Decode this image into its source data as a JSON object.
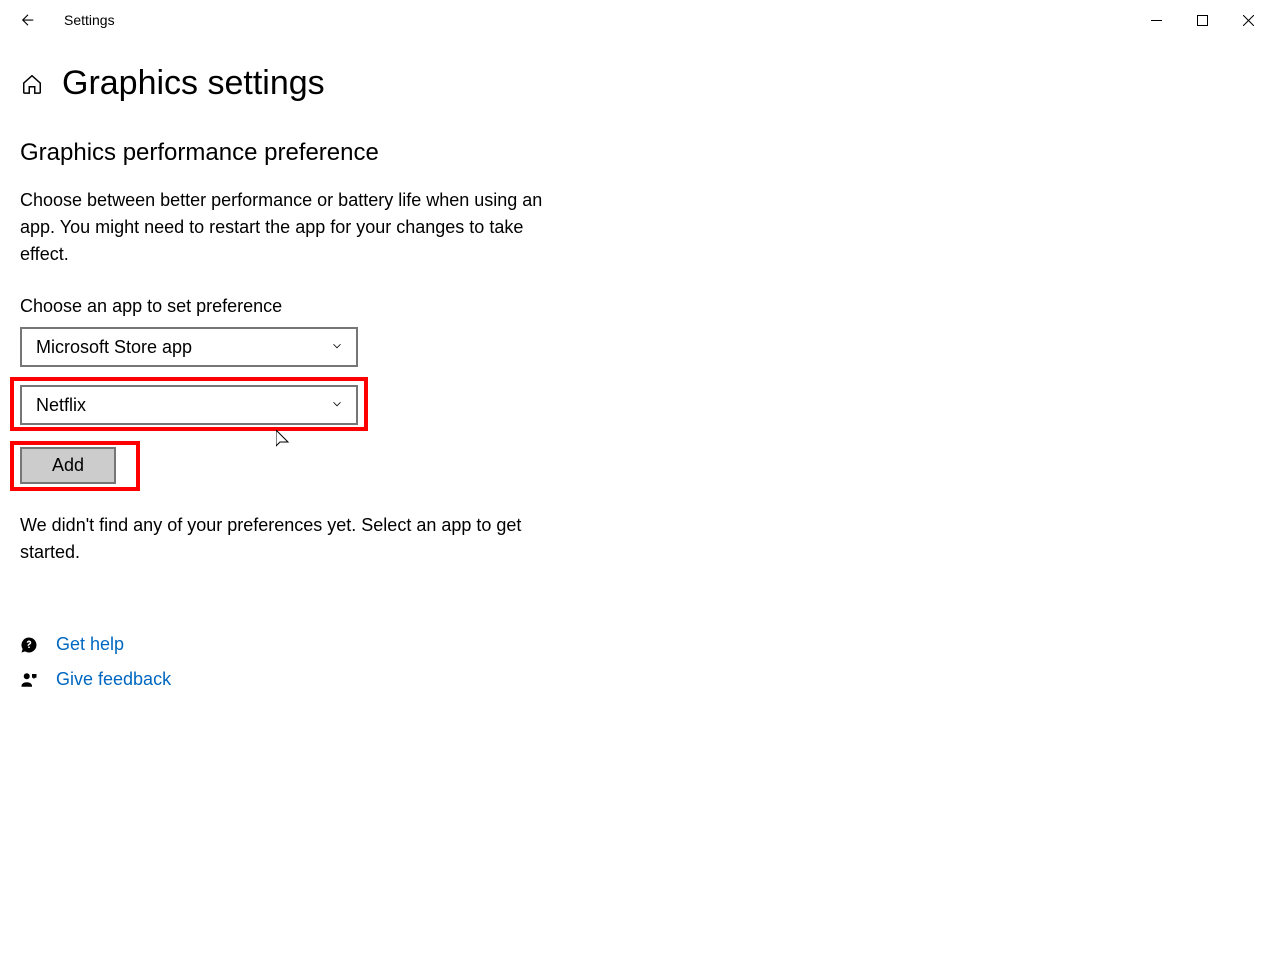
{
  "titlebar": {
    "app_name": "Settings"
  },
  "page": {
    "title": "Graphics settings",
    "section_title": "Graphics performance preference",
    "description": "Choose between better performance or battery life when using an app. You might need to restart the app for your changes to take effect.",
    "dropdown_label": "Choose an app to set preference",
    "dropdown1_value": "Microsoft Store app",
    "dropdown2_value": "Netflix",
    "add_button_label": "Add",
    "status_text": "We didn't find any of your preferences yet. Select an app to get started."
  },
  "links": {
    "get_help": "Get help",
    "give_feedback": "Give feedback"
  }
}
